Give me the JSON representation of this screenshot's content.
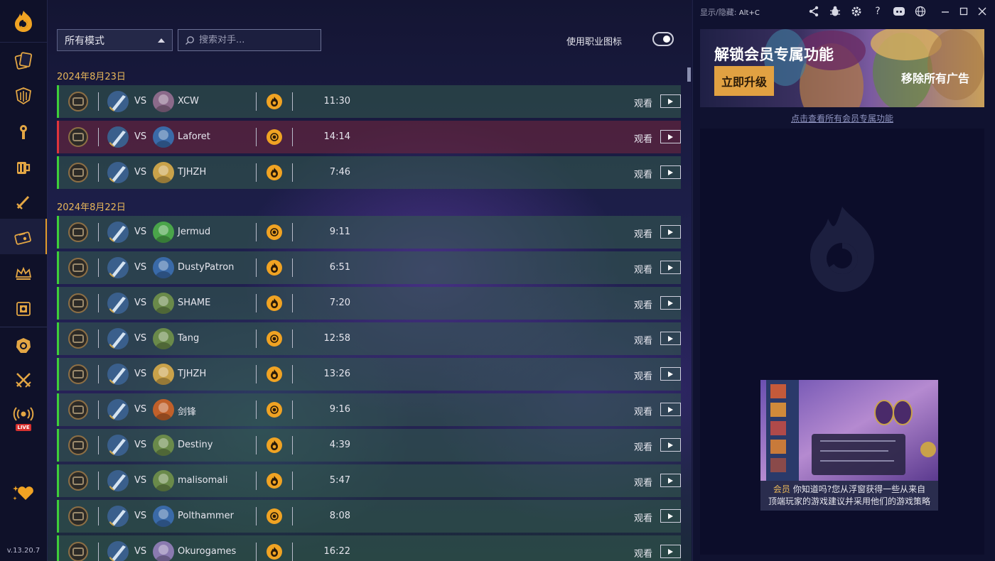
{
  "app": {
    "version": "v.13.20.7",
    "hotkey_label": "显示/隐藏:",
    "hotkey_value": "Alt+C"
  },
  "sidebar": {
    "items": [
      {
        "name": "sidebar-item-card-collection",
        "icon": "cards-icon"
      },
      {
        "name": "sidebar-item-decks",
        "icon": "shield-grid-icon"
      },
      {
        "name": "sidebar-item-arena",
        "icon": "trophy-torch-icon"
      },
      {
        "name": "sidebar-item-tavern",
        "icon": "tankard-icon"
      },
      {
        "name": "sidebar-item-battlegrounds",
        "icon": "sword-icon"
      },
      {
        "name": "sidebar-item-replays",
        "icon": "ticket-icon",
        "active": true
      },
      {
        "name": "sidebar-item-leaderboard",
        "icon": "crown-icon"
      },
      {
        "name": "sidebar-item-card-packs",
        "icon": "card-pack-icon"
      },
      {
        "name": "sidebar-item-hero",
        "icon": "lion-head-icon"
      },
      {
        "name": "sidebar-item-duels",
        "icon": "crossed-swords-icon"
      },
      {
        "name": "sidebar-item-live",
        "icon": "live-broadcast-icon",
        "badge": "LIVE"
      },
      {
        "name": "sidebar-item-favorite",
        "icon": "heart-sparkle-icon"
      }
    ]
  },
  "filters": {
    "mode_selected": "所有模式",
    "search_placeholder": "搜索对手...",
    "toggle_label": "使用职业图标",
    "toggle_on": true
  },
  "groups": [
    {
      "date": "2024年8月23日",
      "games": [
        {
          "opponent": "XCW",
          "duration": "11:30",
          "result": "win",
          "outcome": "flame",
          "opp_avatar": "#8b6a8a"
        },
        {
          "opponent": "Laforet",
          "duration": "14:14",
          "result": "loss",
          "outcome": "coin",
          "opp_avatar": "#3a6aa8"
        },
        {
          "opponent": "TJHZH",
          "duration": "7:46",
          "result": "win",
          "outcome": "flame",
          "opp_avatar": "#c9a24a"
        }
      ]
    },
    {
      "date": "2024年8月22日",
      "games": [
        {
          "opponent": "Jermud",
          "duration": "9:11",
          "result": "win",
          "outcome": "coin",
          "opp_avatar": "#4aa54a"
        },
        {
          "opponent": "DustyPatron",
          "duration": "6:51",
          "result": "win",
          "outcome": "flame",
          "opp_avatar": "#3a6aa8"
        },
        {
          "opponent": "SHAME",
          "duration": "7:20",
          "result": "win",
          "outcome": "flame",
          "opp_avatar": "#6a8a4a"
        },
        {
          "opponent": "Tang",
          "duration": "12:58",
          "result": "win",
          "outcome": "coin",
          "opp_avatar": "#6a8a4a"
        },
        {
          "opponent": "TJHZH",
          "duration": "13:26",
          "result": "win",
          "outcome": "flame",
          "opp_avatar": "#c9a24a"
        },
        {
          "opponent": "剑锋",
          "duration": "9:16",
          "result": "win",
          "outcome": "coin",
          "opp_avatar": "#c0602a"
        },
        {
          "opponent": "Destiny",
          "duration": "4:39",
          "result": "win",
          "outcome": "flame",
          "opp_avatar": "#6a8a4a"
        },
        {
          "opponent": "malisomali",
          "duration": "5:47",
          "result": "win",
          "outcome": "flame",
          "opp_avatar": "#6a8a4a"
        },
        {
          "opponent": "Polthammer",
          "duration": "8:08",
          "result": "win",
          "outcome": "coin",
          "opp_avatar": "#3a6aa8"
        },
        {
          "opponent": "Okurogames",
          "duration": "16:22",
          "result": "win",
          "outcome": "flame",
          "opp_avatar": "#8a7ab0"
        }
      ]
    }
  ],
  "row_labels": {
    "vs": "VS",
    "watch": "观看"
  },
  "banner": {
    "title": "解锁会员专属功能",
    "cta": "立即升级",
    "remove_ads": "移除所有广告",
    "link": "点击查看所有会员专属功能"
  },
  "promo": {
    "tag": "会员",
    "text_line1": "你知道吗?您从浮窗获得一些从来自",
    "text_line2": "顶端玩家的游戏建议并采用他们的游戏策略"
  },
  "colors": {
    "accent": "#e39b2c",
    "win": "#3ecf3a",
    "loss": "#e0343c",
    "date": "#e8b75a"
  }
}
